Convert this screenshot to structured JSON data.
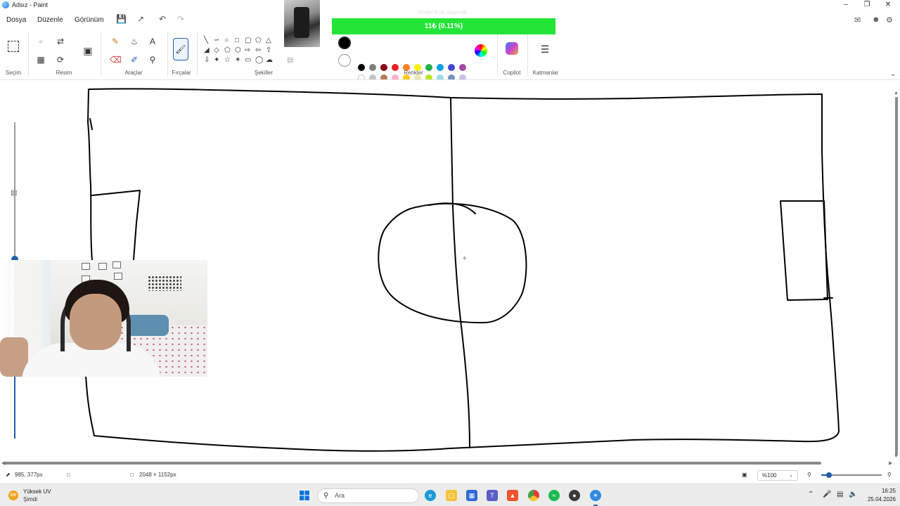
{
  "window": {
    "title": "Adsız - Paint"
  },
  "menu": [
    "Dosya",
    "Düzenle",
    "Görünüm"
  ],
  "ribbon": {
    "groups": {
      "selection": "Seçim",
      "image": "Resim",
      "tools": "Araçlar",
      "brushes": "Fırçalar",
      "shapes": "Şekiller",
      "colors": "Renkler",
      "copilot": "Copilot",
      "layers": "Katmanlar"
    },
    "palette_row1": [
      "#000000",
      "#7f7f7f",
      "#880015",
      "#ed1c24",
      "#ff7f27",
      "#fff200",
      "#22b14c",
      "#00a2e8",
      "#3f48cc",
      "#a349a4"
    ],
    "palette_row2": [
      "",
      "#c3c3c3",
      "#b97a57",
      "#ffaec9",
      "#ffc90e",
      "#efe4b0",
      "#b5e61d",
      "#99d9ea",
      "#7092be",
      "#c8bfe7"
    ]
  },
  "overlay": {
    "donation_bar_text": "11₺ (0.11%)",
    "donation_caption": "Hedef ₺'ye ulaşmak",
    "donation_progress": 0.0011
  },
  "status": {
    "cursor_position": "985, 377px",
    "canvas_size": "2048 × 1152px",
    "zoom": "%100"
  },
  "taskbar": {
    "weather_title": "Yüksek UV",
    "weather_subtitle": "Şimdi",
    "weather_badge": "UV",
    "search_placeholder": "Ara",
    "time": "16:25",
    "date": "25.04.2026"
  }
}
